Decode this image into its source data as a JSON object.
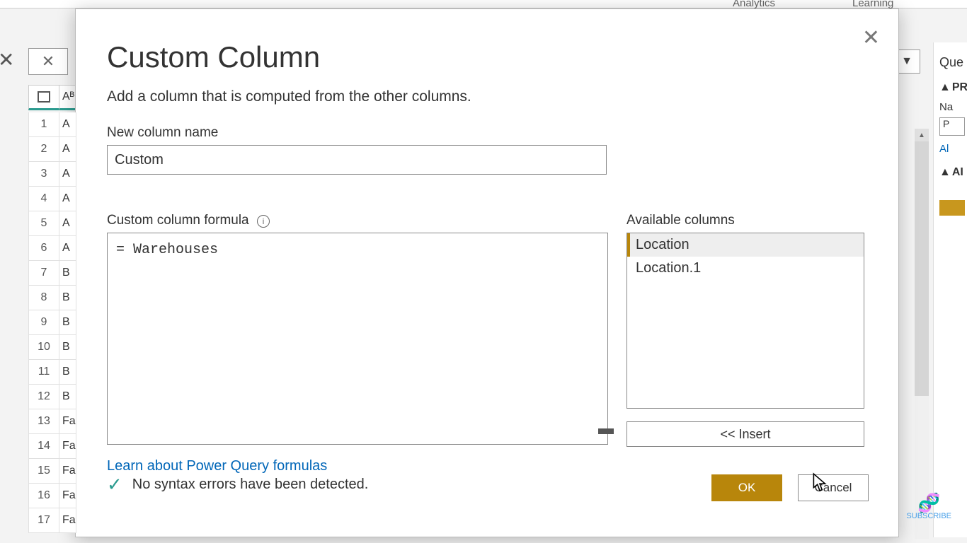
{
  "ribbon": {
    "analytics": "Analytics",
    "learning": "Learning"
  },
  "background": {
    "close": "✕",
    "col_header": "Aᴮ",
    "rows": [
      {
        "n": "1",
        "v": "A"
      },
      {
        "n": "2",
        "v": "A"
      },
      {
        "n": "3",
        "v": "A"
      },
      {
        "n": "4",
        "v": "A"
      },
      {
        "n": "5",
        "v": "A"
      },
      {
        "n": "6",
        "v": "A"
      },
      {
        "n": "7",
        "v": "B"
      },
      {
        "n": "8",
        "v": "B"
      },
      {
        "n": "9",
        "v": "B"
      },
      {
        "n": "10",
        "v": "B"
      },
      {
        "n": "11",
        "v": "B"
      },
      {
        "n": "12",
        "v": "B"
      },
      {
        "n": "13",
        "v": "Fa"
      },
      {
        "n": "14",
        "v": "Fa"
      },
      {
        "n": "15",
        "v": "Fa"
      },
      {
        "n": "16",
        "v": "Fa"
      },
      {
        "n": "17",
        "v": "Fa"
      }
    ]
  },
  "rightpanel": {
    "title": "Que",
    "properties": "PR",
    "name_label": "Na",
    "name_value": "P",
    "all_props": "Al",
    "applied": "AI"
  },
  "dialog": {
    "title": "Custom Column",
    "subtitle": "Add a column that is computed from the other columns.",
    "name_label": "New column name",
    "name_value": "Custom",
    "formula_label": "Custom column formula",
    "formula_value": "= Warehouses",
    "available_label": "Available columns",
    "available_columns": [
      "Location",
      "Location.1"
    ],
    "insert_label": "<< Insert",
    "learn_link": "Learn about Power Query formulas",
    "status_text": "No syntax errors have been detected.",
    "ok_label": "OK",
    "cancel_label": "Cancel"
  },
  "subscribe": {
    "label": "SUBSCRIBE"
  }
}
